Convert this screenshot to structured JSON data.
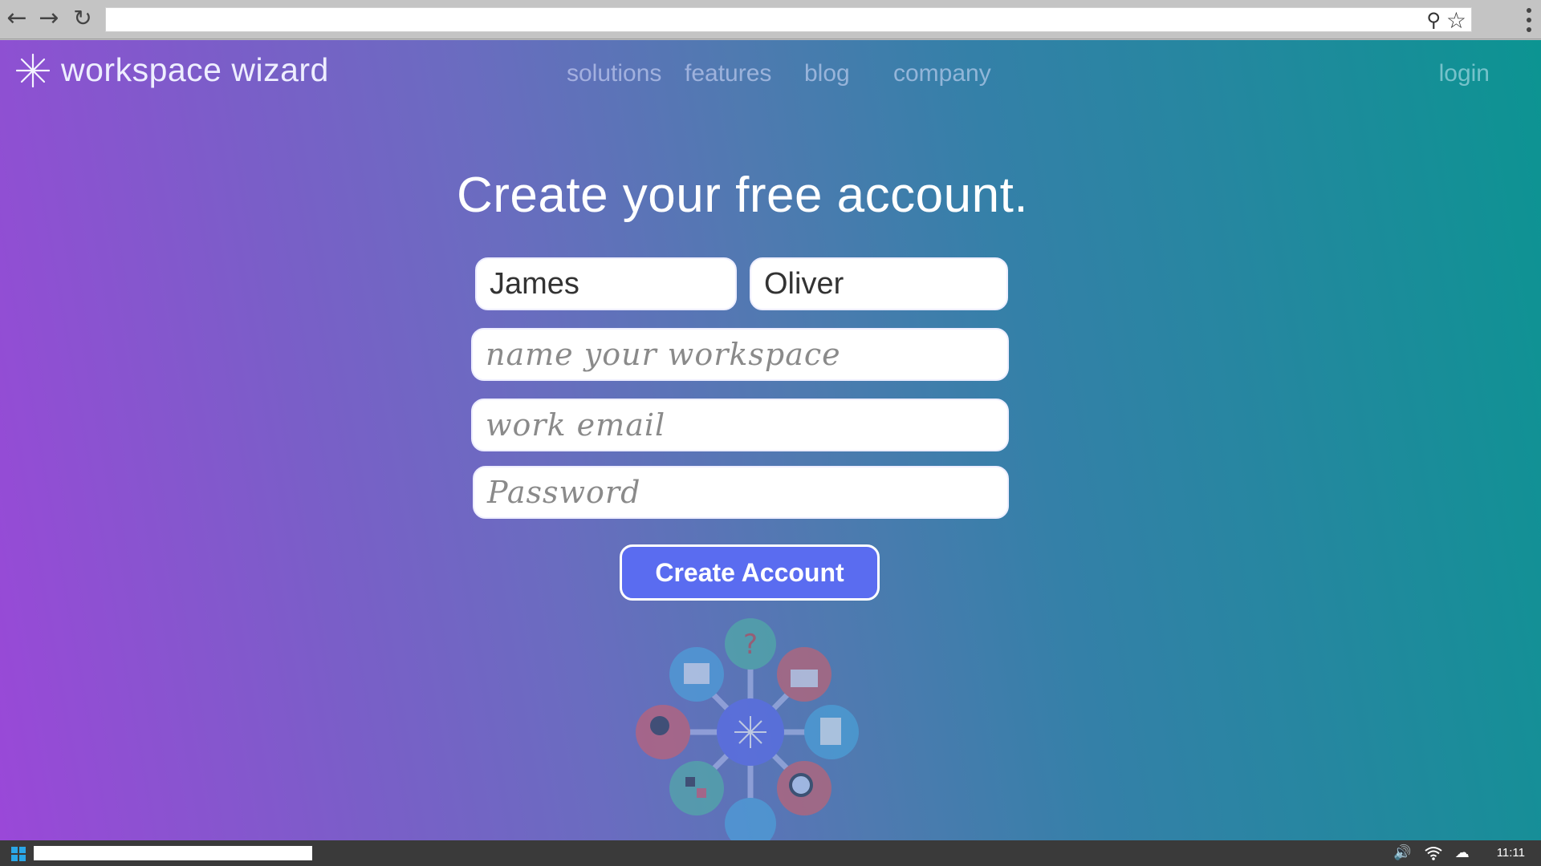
{
  "browser": {
    "back_icon": "←",
    "forward_icon": "→",
    "reload_icon": "↻",
    "url": "",
    "search_icon": "🔍",
    "bookmark_icon": "☆"
  },
  "site": {
    "brand": "workspace wizard",
    "nav": [
      "solutions",
      "features",
      "blog",
      "company"
    ],
    "login": "login"
  },
  "signup": {
    "heading": "Create your free account.",
    "first_name": "James",
    "last_name": "Oliver",
    "workspace_placeholder": "name your workspace",
    "email_placeholder": "work email",
    "password_placeholder": "Password",
    "submit_label": "Create Account"
  },
  "colors": {
    "gradient_left": "#9a48d8",
    "gradient_right": "#0c9492",
    "button": "#5a6cf0"
  },
  "taskbar": {
    "start_icon": "windows-logo",
    "volume_icon": "🔊",
    "wifi_icon": "wifi",
    "cloud_icon": "☁",
    "clock": "11:11"
  }
}
